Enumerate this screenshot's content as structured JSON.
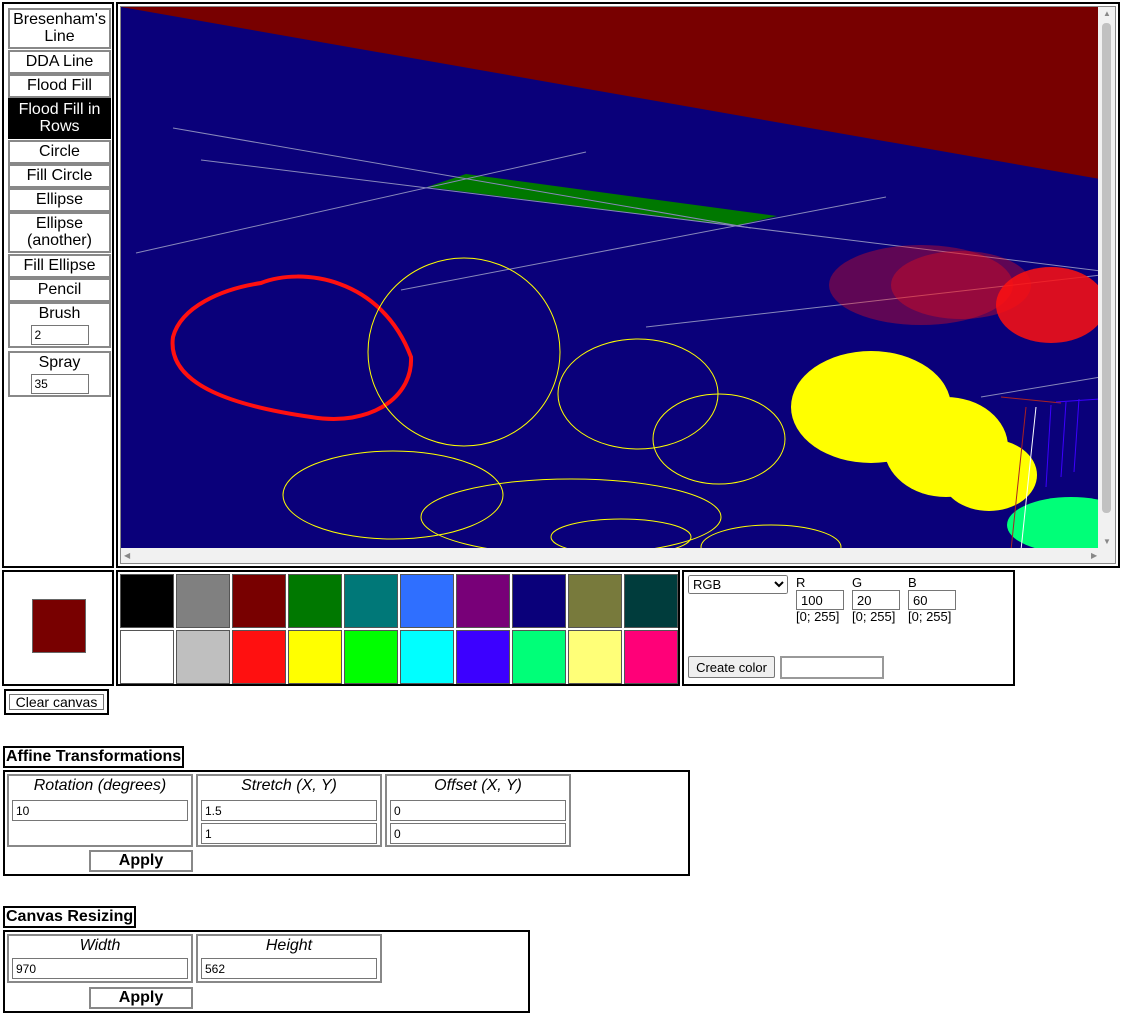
{
  "tools": [
    {
      "label": "Bresenham's Line",
      "active": false
    },
    {
      "label": "DDA Line",
      "active": false
    },
    {
      "label": "Flood Fill",
      "active": false
    },
    {
      "label": "Flood Fill in Rows",
      "active": true
    },
    {
      "label": "Circle",
      "active": false
    },
    {
      "label": "Fill Circle",
      "active": false
    },
    {
      "label": "Ellipse",
      "active": false
    },
    {
      "label": "Ellipse (another)",
      "active": false
    },
    {
      "label": "Fill Ellipse",
      "active": false
    },
    {
      "label": "Pencil",
      "active": false
    },
    {
      "label": "Brush",
      "active": false,
      "value": "2"
    },
    {
      "label": "Spray",
      "active": false,
      "value": "35"
    }
  ],
  "current_color": "#780000",
  "palette": [
    [
      "#000000",
      "#808080",
      "#780000",
      "#007800",
      "#007878",
      "#2f6fff",
      "#780078",
      "#0a007a",
      "#787a3c",
      "#003c3c"
    ],
    [
      "#ffffff",
      "#bfbfbf",
      "#ff1010",
      "#ffff00",
      "#00ff00",
      "#00ffff",
      "#3c00ff",
      "#00ff78",
      "#ffff78",
      "#ff0078"
    ]
  ],
  "picker": {
    "mode": "RGB",
    "channels": [
      {
        "label": "R",
        "value": "100",
        "range": "[0; 255]"
      },
      {
        "label": "G",
        "value": "20",
        "range": "[0; 255]"
      },
      {
        "label": "B",
        "value": "60",
        "range": "[0; 255]"
      }
    ],
    "create_label": "Create color"
  },
  "clear_label": "Clear canvas",
  "affine": {
    "title": "Affine Transformations",
    "rotation_label": "Rotation (degrees)",
    "rotation": "10",
    "stretch_label": "Stretch (X, Y)",
    "stretch_x": "1.5",
    "stretch_y": "1",
    "offset_label": "Offset (X, Y)",
    "offset_x": "0",
    "offset_y": "0",
    "apply_label": "Apply"
  },
  "resize": {
    "title": "Canvas Resizing",
    "width_label": "Width",
    "width": "970",
    "height_label": "Height",
    "height": "562",
    "apply_label": "Apply"
  },
  "canvas_colors": {
    "background": "#0a007a",
    "dark_red": "#780000",
    "green": "#007800",
    "red": "#ff1010",
    "yellow": "#ffff00",
    "mint": "#00ff78",
    "light_line": "#8888bb"
  }
}
